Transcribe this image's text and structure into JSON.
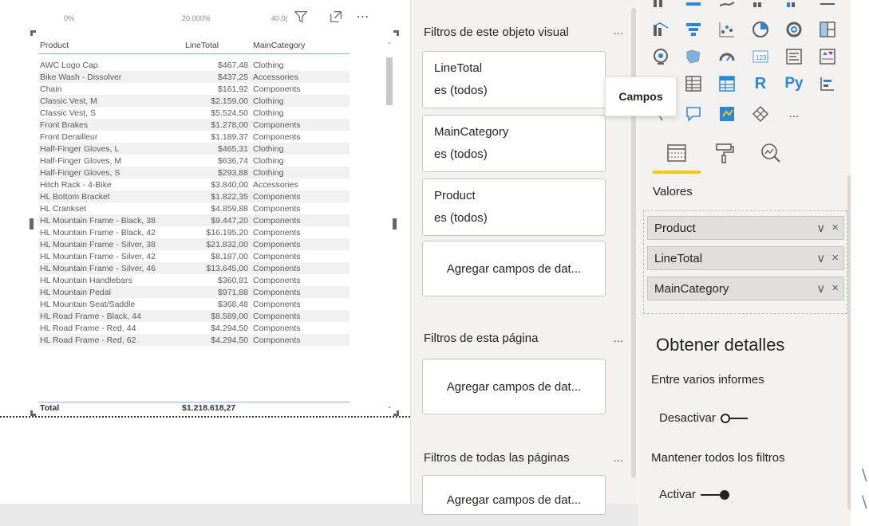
{
  "visual": {
    "scale_labels": [
      "0%",
      "20.000%",
      "40.0("
    ],
    "columns": [
      "Product",
      "LineTotal",
      "MainCategory"
    ],
    "rows": [
      [
        "AWC Logo Cap",
        "$467,48",
        "Clothing"
      ],
      [
        "Bike Wash - Dissolver",
        "$437,25",
        "Accessories"
      ],
      [
        "Chain",
        "$161,92",
        "Components"
      ],
      [
        "Classic Vest, M",
        "$2.159,00",
        "Clothing"
      ],
      [
        "Classic Vest, S",
        "$5.524,50",
        "Clothing"
      ],
      [
        "Front Brakes",
        "$1.278,00",
        "Components"
      ],
      [
        "Front Derailleur",
        "$1.189,37",
        "Components"
      ],
      [
        "Half-Finger Gloves, L",
        "$465,31",
        "Clothing"
      ],
      [
        "Half-Finger Gloves, M",
        "$636,74",
        "Clothing"
      ],
      [
        "Half-Finger Gloves, S",
        "$293,88",
        "Clothing"
      ],
      [
        "Hitch Rack - 4-Bike",
        "$3.840,00",
        "Accessories"
      ],
      [
        "HL Bottom Bracket",
        "$1.822,35",
        "Components"
      ],
      [
        "HL Crankset",
        "$4.859,88",
        "Components"
      ],
      [
        "HL Mountain Frame - Black, 38",
        "$9.447,20",
        "Components"
      ],
      [
        "HL Mountain Frame - Black, 42",
        "$16.195,20",
        "Components"
      ],
      [
        "HL Mountain Frame - Silver, 38",
        "$21.832,00",
        "Components"
      ],
      [
        "HL Mountain Frame - Silver, 42",
        "$8.187,00",
        "Components"
      ],
      [
        "HL Mountain Frame - Silver, 46",
        "$13.645,00",
        "Components"
      ],
      [
        "HL Mountain Handlebars",
        "$360,81",
        "Components"
      ],
      [
        "HL Mountain Pedal",
        "$971,88",
        "Components"
      ],
      [
        "HL Mountain Seat/Saddle",
        "$368,48",
        "Components"
      ],
      [
        "HL Road Frame - Black, 44",
        "$8.589,00",
        "Components"
      ],
      [
        "HL Road Frame - Red, 44",
        "$4.294,50",
        "Components"
      ],
      [
        "HL Road Frame - Red, 62",
        "$4.294,50",
        "Components"
      ]
    ],
    "total_label": "Total",
    "total_value": "$1.218.618,27"
  },
  "filters": {
    "visual_section": "Filtros de este objeto visual",
    "more": "...",
    "cards": [
      {
        "field": "LineTotal",
        "value": "es (todos)"
      },
      {
        "field": "MainCategory",
        "value": "es (todos)"
      },
      {
        "field": "Product",
        "value": "es (todos)"
      }
    ],
    "add_fields": "Agregar campos de dat...",
    "page_section": "Filtros de esta página",
    "all_pages_section": "Filtros de todas las páginas"
  },
  "visualizations": {
    "tooltip": "Campos",
    "r_label": "R",
    "py_label": "Py",
    "more": "...",
    "values_label": "Valores",
    "wells": [
      "Product",
      "LineTotal",
      "MainCategory"
    ],
    "well_chevron": "∨",
    "well_close": "×",
    "details_title": "Obtener detalles",
    "cross_report_label": "Entre varios informes",
    "cross_report_toggle": "Desactivar",
    "keep_filters_label": "Mantener todos los filtros",
    "keep_filters_toggle": "Activar"
  },
  "colors": {
    "accent_yellow": "#f2c811",
    "pane_bg": "#f3f2f1",
    "header_rule": "#8ab4e6"
  }
}
